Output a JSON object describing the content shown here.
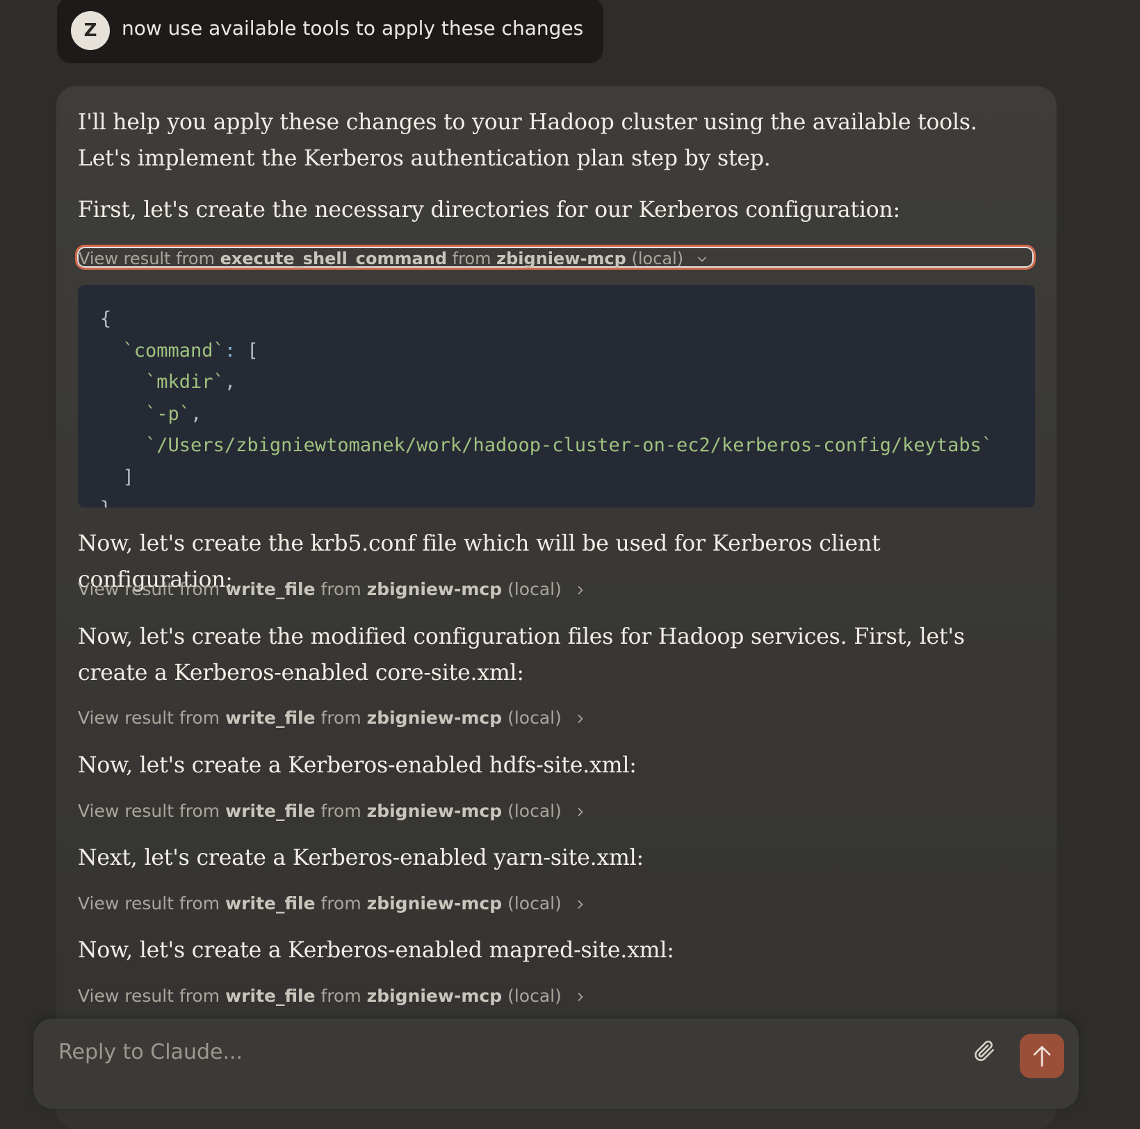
{
  "user_message": {
    "avatar_initial": "Z",
    "text": "now use available tools to apply these changes"
  },
  "assistant": {
    "intro": "I'll help you apply these changes to your Hadoop cluster using the available tools. Let's implement the Kerberos authentication plan step by step.",
    "step1_text": "First, let's create the necessary directories for our Kerberos configuration:",
    "tool_results": [
      {
        "prefix": "View result from",
        "tool": "execute_shell_command",
        "from": "from",
        "server": "zbigniew-mcp",
        "scope": "(local)",
        "expanded": true
      },
      {
        "prefix": "View result from",
        "tool": "write_file",
        "from": "from",
        "server": "zbigniew-mcp",
        "scope": "(local)",
        "expanded": false
      },
      {
        "prefix": "View result from",
        "tool": "write_file",
        "from": "from",
        "server": "zbigniew-mcp",
        "scope": "(local)",
        "expanded": false
      },
      {
        "prefix": "View result from",
        "tool": "write_file",
        "from": "from",
        "server": "zbigniew-mcp",
        "scope": "(local)",
        "expanded": false
      },
      {
        "prefix": "View result from",
        "tool": "write_file",
        "from": "from",
        "server": "zbigniew-mcp",
        "scope": "(local)",
        "expanded": false
      },
      {
        "prefix": "View result from",
        "tool": "write_file",
        "from": "from",
        "server": "zbigniew-mcp",
        "scope": "(local)",
        "expanded": false
      }
    ],
    "code": {
      "open_brace": "{",
      "key": "`command`",
      "colon": ":",
      "open_bracket": "[",
      "args": [
        "`mkdir`",
        "`-p`",
        "`/Users/zbigniewtomanek/work/hadoop-cluster-on-ec2/kerberos-config/keytabs`"
      ],
      "close_bracket": "]",
      "close_brace": "}"
    },
    "step2_text": "Now, let's create the krb5.conf file which will be used for Kerberos client configuration:",
    "step3_text": "Now, let's create the modified configuration files for Hadoop services. First, let's create a Kerberos-enabled core-site.xml:",
    "step4_text": "Now, let's create a Kerberos-enabled hdfs-site.xml:",
    "step5_text": "Next, let's create a Kerberos-enabled yarn-site.xml:",
    "step6_text": "Now, let's create a Kerberos-enabled mapred-site.xml:"
  },
  "reply": {
    "placeholder": "Reply to Claude...",
    "value": ""
  },
  "icons": {
    "attach": "paperclip-icon",
    "send": "arrow-up-icon",
    "expand": "chevron-down-icon",
    "collapse": "chevron-right-icon"
  },
  "colors": {
    "background": "#2e2d2b",
    "card": "#3b3a37",
    "accent": "#d06a4a",
    "send_button": "#9c4f38",
    "code_bg": "#262a35",
    "code_string": "#9fc27f"
  }
}
